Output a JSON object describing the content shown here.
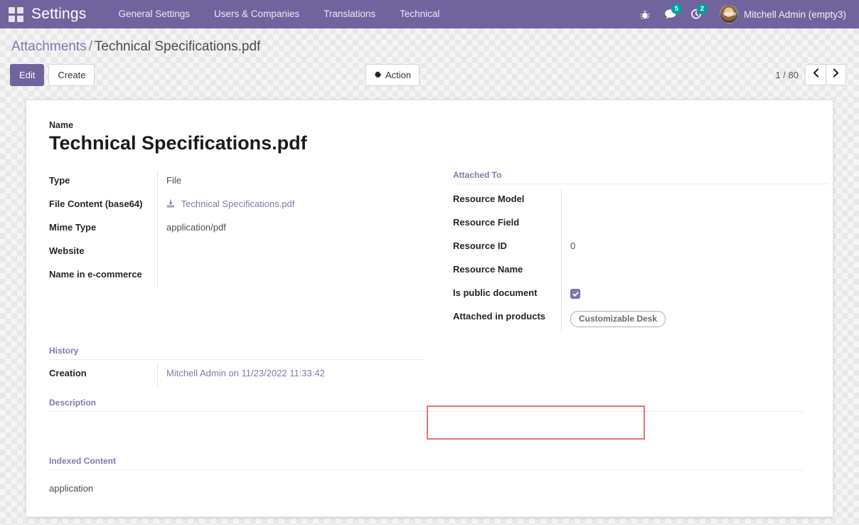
{
  "navbar": {
    "apps_icon": "grid-apps-icon",
    "brand": "Settings",
    "menus": [
      {
        "label": "General Settings"
      },
      {
        "label": "Users & Companies"
      },
      {
        "label": "Translations"
      },
      {
        "label": "Technical"
      }
    ],
    "debug_icon": "bug-icon",
    "messages": {
      "icon": "chat-icon",
      "count": "5"
    },
    "activities": {
      "icon": "clock-icon",
      "count": "2"
    },
    "user": {
      "name": "Mitchell Admin (empty3)",
      "avatar": "user-avatar"
    },
    "bg_color": "#71639e"
  },
  "control_panel": {
    "breadcrumb": {
      "root": "Attachments",
      "separator": "/",
      "current": "Technical Specifications.pdf"
    },
    "buttons": {
      "edit": "Edit",
      "create": "Create"
    },
    "action": {
      "label": "Action",
      "icon": "gear-icon"
    },
    "pager": {
      "count": "1 / 80",
      "prev_icon": "chevron-left-icon",
      "next_icon": "chevron-right-icon"
    }
  },
  "form": {
    "name_label": "Name",
    "name_value": "Technical Specifications.pdf",
    "left_fields": [
      {
        "label": "Type",
        "value": "File",
        "kind": "text"
      },
      {
        "label": "File Content (base64)",
        "value": "Technical Specifications.pdf",
        "kind": "link"
      },
      {
        "label": "Mime Type",
        "value": "application/pdf",
        "kind": "text"
      },
      {
        "label": "Website",
        "value": "",
        "kind": "text"
      },
      {
        "label": "Name in e-commerce",
        "value": "",
        "kind": "text"
      }
    ],
    "attached_to": {
      "title": "Attached To",
      "fields": [
        {
          "label": "Resource Model",
          "value": "",
          "kind": "text"
        },
        {
          "label": "Resource Field",
          "value": "",
          "kind": "text"
        },
        {
          "label": "Resource ID",
          "value": "0",
          "kind": "text"
        },
        {
          "label": "Resource Name",
          "value": "",
          "kind": "text"
        },
        {
          "label": "Is public document",
          "value": "",
          "kind": "checkbox",
          "checked": true
        },
        {
          "label": "Attached in products",
          "value": "Customizable Desk",
          "kind": "tag"
        }
      ]
    },
    "history": {
      "title": "History",
      "creation_label": "Creation",
      "creation_value": "Mitchell Admin on 11/23/2022 11:33:42"
    },
    "description": {
      "title": "Description",
      "value": ""
    },
    "indexed_content": {
      "title": "Indexed Content",
      "value": "application"
    }
  },
  "highlight": {
    "color": "#f2706e",
    "target": "attached-in-products-row"
  }
}
